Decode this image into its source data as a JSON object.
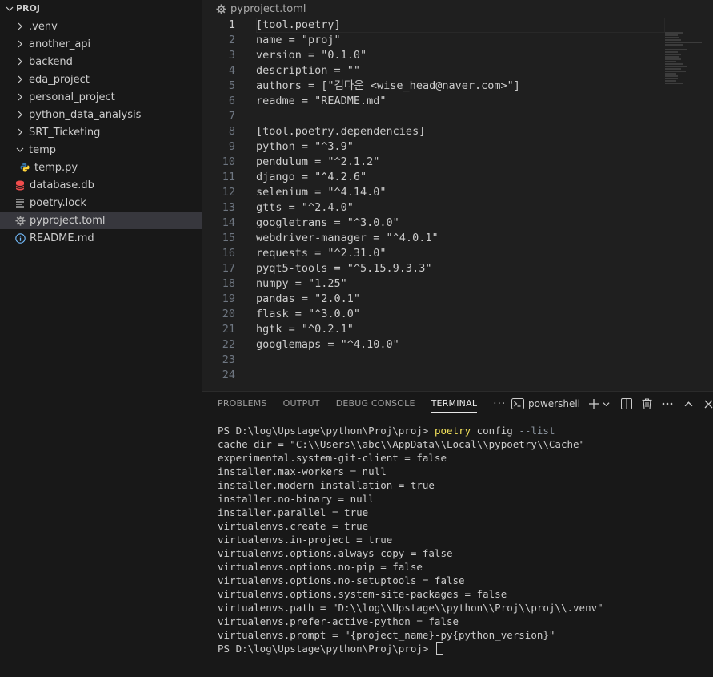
{
  "explorer": {
    "root_label": "PROJ",
    "items": [
      {
        "label": ".venv",
        "type": "folder",
        "state": "collapsed",
        "depth": 1
      },
      {
        "label": "another_api",
        "type": "folder",
        "state": "collapsed",
        "depth": 1
      },
      {
        "label": "backend",
        "type": "folder",
        "state": "collapsed",
        "depth": 1
      },
      {
        "label": "eda_project",
        "type": "folder",
        "state": "collapsed",
        "depth": 1
      },
      {
        "label": "personal_project",
        "type": "folder",
        "state": "collapsed",
        "depth": 1
      },
      {
        "label": "python_data_analysis",
        "type": "folder",
        "state": "collapsed",
        "depth": 1
      },
      {
        "label": "SRT_Ticketing",
        "type": "folder",
        "state": "collapsed",
        "depth": 1
      },
      {
        "label": "temp",
        "type": "folder",
        "state": "expanded",
        "depth": 1
      },
      {
        "label": "temp.py",
        "type": "python",
        "depth": 2
      },
      {
        "label": "database.db",
        "type": "database",
        "depth": 1
      },
      {
        "label": "poetry.lock",
        "type": "lines",
        "depth": 1
      },
      {
        "label": "pyproject.toml",
        "type": "gear",
        "depth": 1,
        "selected": true
      },
      {
        "label": "README.md",
        "type": "info",
        "depth": 1
      }
    ]
  },
  "editor": {
    "breadcrumb": "pyproject.toml",
    "current_line": 1,
    "lines": [
      {
        "n": "1",
        "text": "[tool.poetry]"
      },
      {
        "n": "2",
        "text": "name = \"proj\""
      },
      {
        "n": "3",
        "text": "version = \"0.1.0\""
      },
      {
        "n": "4",
        "text": "description = \"\""
      },
      {
        "n": "5",
        "text": "authors = [\"김다운 <wise_head@naver.com>\"]"
      },
      {
        "n": "6",
        "text": "readme = \"README.md\""
      },
      {
        "n": "7",
        "text": ""
      },
      {
        "n": "8",
        "text": "[tool.poetry.dependencies]"
      },
      {
        "n": "9",
        "text": "python = \"^3.9\""
      },
      {
        "n": "10",
        "text": "pendulum = \"^2.1.2\""
      },
      {
        "n": "11",
        "text": "django = \"^4.2.6\""
      },
      {
        "n": "12",
        "text": "selenium = \"^4.14.0\""
      },
      {
        "n": "13",
        "text": "gtts = \"^2.4.0\""
      },
      {
        "n": "14",
        "text": "googletrans = \"^3.0.0\""
      },
      {
        "n": "15",
        "text": "webdriver-manager = \"^4.0.1\""
      },
      {
        "n": "16",
        "text": "requests = \"^2.31.0\""
      },
      {
        "n": "17",
        "text": "pyqt5-tools = \"^5.15.9.3.3\""
      },
      {
        "n": "18",
        "text": "numpy = \"1.25\""
      },
      {
        "n": "19",
        "text": "pandas = \"2.0.1\""
      },
      {
        "n": "20",
        "text": "flask = \"^3.0.0\""
      },
      {
        "n": "21",
        "text": "hgtk = \"^0.2.1\""
      },
      {
        "n": "22",
        "text": "googlemaps = \"^4.10.0\""
      },
      {
        "n": "23",
        "text": ""
      },
      {
        "n": "24",
        "text": ""
      }
    ]
  },
  "panel": {
    "tabs": [
      {
        "label": "PROBLEMS",
        "active": false
      },
      {
        "label": "OUTPUT",
        "active": false
      },
      {
        "label": "DEBUG CONSOLE",
        "active": false
      },
      {
        "label": "TERMINAL",
        "active": true
      }
    ],
    "more_label": "···",
    "shell_label": "powershell",
    "terminal": {
      "prompt": "PS D:\\log\\Upstage\\python\\Proj\\proj> ",
      "command_exe": "poetry",
      "command_args": " config ",
      "command_flag": "--list",
      "output": [
        "cache-dir = \"C:\\\\Users\\\\abc\\\\AppData\\\\Local\\\\pypoetry\\\\Cache\"",
        "experimental.system-git-client = false",
        "installer.max-workers = null",
        "installer.modern-installation = true",
        "installer.no-binary = null",
        "installer.parallel = true",
        "virtualenvs.create = true",
        "virtualenvs.in-project = true",
        "virtualenvs.options.always-copy = false",
        "virtualenvs.options.no-pip = false",
        "virtualenvs.options.no-setuptools = false",
        "virtualenvs.options.system-site-packages = false",
        "virtualenvs.path = \"D:\\\\log\\\\Upstage\\\\python\\\\Proj\\\\proj\\\\.venv\"",
        "virtualenvs.prefer-active-python = false",
        "virtualenvs.prompt = \"{project_name}-py{python_version}\""
      ],
      "final_prompt": "PS D:\\log\\Upstage\\python\\Proj\\proj> "
    }
  },
  "colors": {
    "sidebar_bg": "#181818",
    "editor_bg": "#1f1f1f",
    "selection_bg": "#37373d",
    "command_yellow": "#f1e05a",
    "db_icon": "#f14c4c",
    "python_icon_blue": "#3572A5",
    "python_icon_yellow": "#ffd43b",
    "info_icon": "#75beff"
  }
}
